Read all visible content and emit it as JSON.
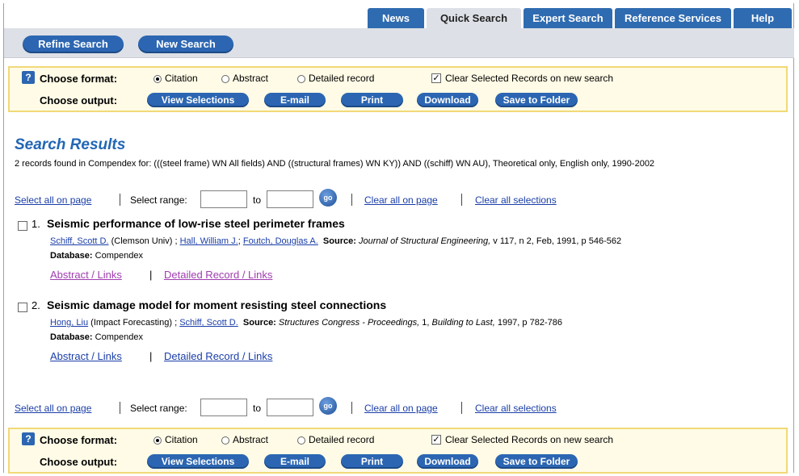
{
  "tabs": [
    "News",
    "Quick Search",
    "Expert Search",
    "Reference Services",
    "Help"
  ],
  "toolbar": {
    "refine": "Refine Search",
    "new": "New Search"
  },
  "format": {
    "label": "Choose format:",
    "options": [
      "Citation",
      "Abstract",
      "Detailed record"
    ],
    "selected": "Citation",
    "clear_checkbox": "Clear Selected Records on new search",
    "clear_checked": true
  },
  "output": {
    "label": "Choose output:",
    "buttons": [
      "View Selections",
      "E-mail",
      "Print",
      "Download",
      "Save to Folder"
    ]
  },
  "results": {
    "heading": "Search Results",
    "summary": "2 records found in Compendex for: (((steel frame) WN All fields) AND ((structural frames) WN KY)) AND ((schiff) WN AU), Theoretical only, English only, 1990-2002"
  },
  "selection": {
    "select_all": "Select all on page",
    "select_range": "Select range:",
    "to": "to",
    "go": "go",
    "clear_page": "Clear all on page",
    "clear_all": "Clear all selections"
  },
  "records": [
    {
      "num": "1.",
      "title": "Seismic performance of low-rise steel perimeter frames",
      "author1": "Schiff, Scott D.",
      "aff1": "(Clemson Univ) ;",
      "author2": "Hall, William J.",
      "author3": "Foutch, Douglas A.",
      "source_label": "Source:",
      "source_journal": "Journal of Structural Engineering,",
      "source_rest": "v 117, n 2, Feb, 1991, p 546-562",
      "db_label": "Database:",
      "db": "Compendex",
      "abstract_link": "Abstract / Links",
      "detailed_link": "Detailed Record / Links"
    },
    {
      "num": "2.",
      "title": "Seismic damage model for moment resisting steel connections",
      "author1": "Hong, Liu",
      "aff1": "(Impact Forecasting) ;",
      "author2": "Schiff, Scott D.",
      "source_label": "Source:",
      "source_journal": "Structures Congress - Proceedings,",
      "source_mid": "1,",
      "source_ital2": "Building to Last,",
      "source_rest": "1997, p 782-786",
      "db_label": "Database:",
      "db": "Compendex",
      "abstract_link": "Abstract / Links",
      "detailed_link": "Detailed Record / Links"
    }
  ],
  "colors": {
    "tab_blue": "#2f6bb0",
    "box_yellow": "#fffbe6",
    "heading_blue": "#2266b5"
  }
}
